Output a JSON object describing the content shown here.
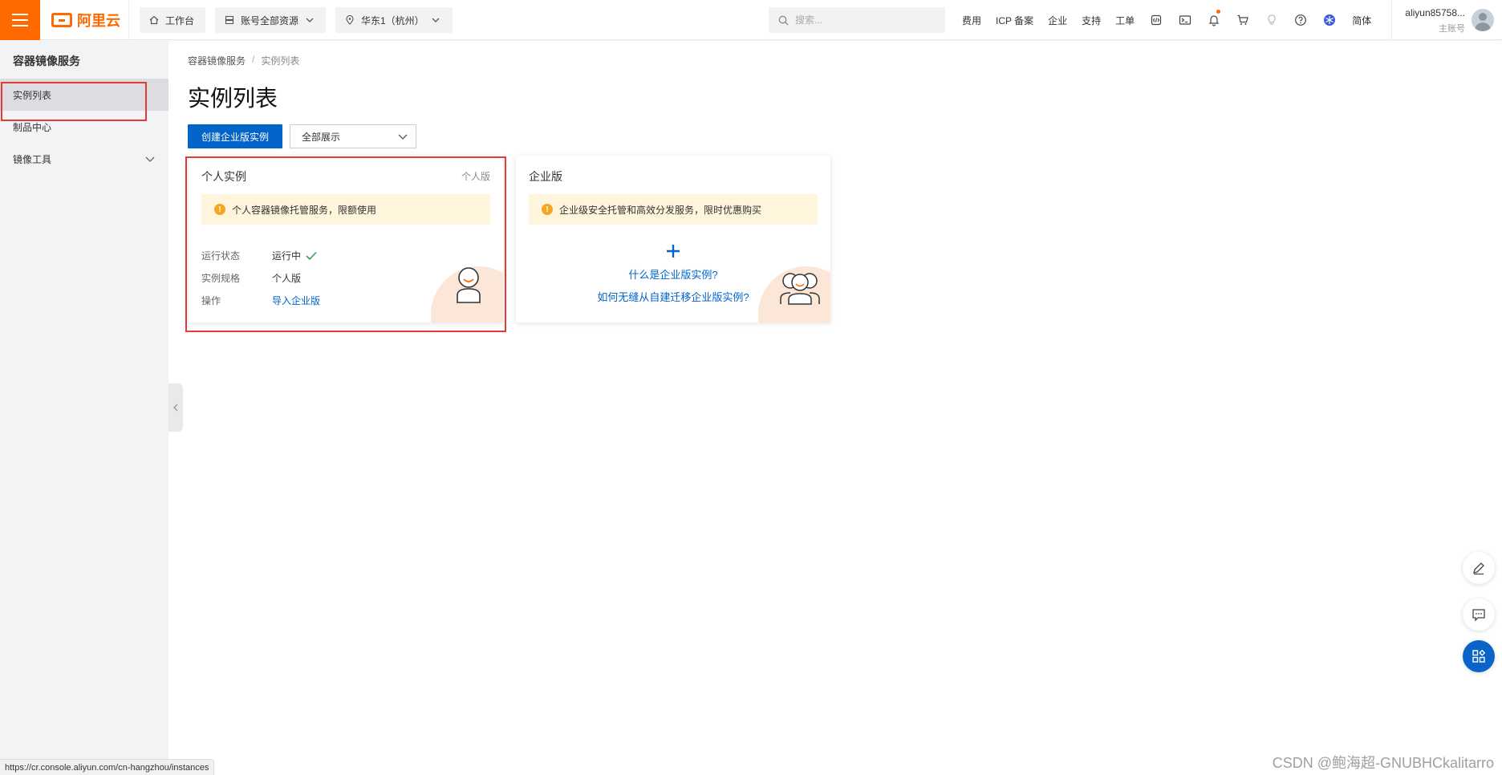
{
  "topbar": {
    "logo_text": "阿里云",
    "workbench": "工作台",
    "account_resources": "账号全部资源",
    "region": "华东1（杭州）",
    "search_placeholder": "搜索...",
    "links": [
      "费用",
      "ICP 备案",
      "企业",
      "支持",
      "工单"
    ],
    "lang": "简体",
    "user_name": "aliyun85758...",
    "user_role": "主账号"
  },
  "sidebar": {
    "title": "容器镜像服务",
    "items": [
      {
        "label": "实例列表",
        "active": true
      },
      {
        "label": "制品中心"
      },
      {
        "label": "镜像工具",
        "expandable": true
      }
    ]
  },
  "main": {
    "breadcrumb": [
      "容器镜像服务",
      "实例列表"
    ],
    "title": "实例列表",
    "create_button": "创建企业版实例",
    "filter_value": "全部展示",
    "personal_card": {
      "title": "个人实例",
      "tag": "个人版",
      "notice": "个人容器镜像托管服务，限额使用",
      "fields": [
        {
          "label": "运行状态",
          "value": "运行中"
        },
        {
          "label": "实例规格",
          "value": "个人版"
        },
        {
          "label": "操作",
          "value": "导入企业版"
        }
      ]
    },
    "enterprise_card": {
      "title": "企业版",
      "notice": "企业级安全托管和高效分发服务，限时优惠购买",
      "link1": "什么是企业版实例?",
      "link2": "如何无缝从自建迁移企业版实例?"
    }
  },
  "statusbar_url": "https://cr.console.aliyun.com/cn-hangzhou/instances",
  "watermark": "CSDN @鲍海超-GNUBHCkalitarro",
  "colors": {
    "brand": "#ff6a00",
    "primary": "#0064c8",
    "highlight": "#e53935",
    "notice_bg": "#fff5dc"
  }
}
